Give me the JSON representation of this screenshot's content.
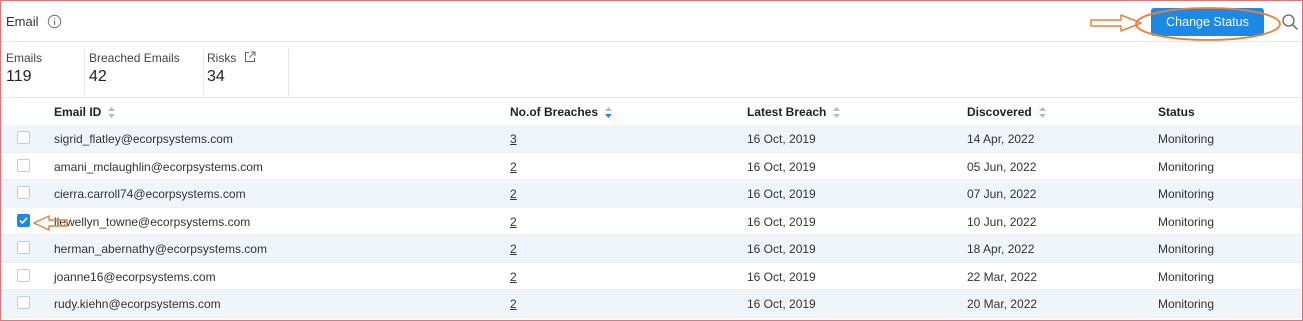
{
  "header": {
    "title": "Email",
    "change_status_label": "Change Status"
  },
  "stats": [
    {
      "label": "Emails",
      "value": "119"
    },
    {
      "label": "Breached Emails",
      "value": "42"
    },
    {
      "label": "Risks",
      "value": "34"
    }
  ],
  "table": {
    "columns": [
      "Email ID",
      "No.of Breaches",
      "Latest Breach",
      "Discovered",
      "Status"
    ],
    "rows": [
      {
        "email": "sigrid_flatley@ecorpsystems.com",
        "breaches": "3",
        "latest": "16 Oct, 2019",
        "discovered": "14 Apr, 2022",
        "status": "Monitoring",
        "checked": false
      },
      {
        "email": "amani_mclaughlin@ecorpsystems.com",
        "breaches": "2",
        "latest": "16 Oct, 2019",
        "discovered": "05 Jun, 2022",
        "status": "Monitoring",
        "checked": false
      },
      {
        "email": "cierra.carroll74@ecorpsystems.com",
        "breaches": "2",
        "latest": "16 Oct, 2019",
        "discovered": "07 Jun, 2022",
        "status": "Monitoring",
        "checked": false
      },
      {
        "email": "llewellyn_towne@ecorpsystems.com",
        "breaches": "2",
        "latest": "16 Oct, 2019",
        "discovered": "10 Jun, 2022",
        "status": "Monitoring",
        "checked": true
      },
      {
        "email": "herman_abernathy@ecorpsystems.com",
        "breaches": "2",
        "latest": "16 Oct, 2019",
        "discovered": "18 Apr, 2022",
        "status": "Monitoring",
        "checked": false
      },
      {
        "email": "joanne16@ecorpsystems.com",
        "breaches": "2",
        "latest": "16 Oct, 2019",
        "discovered": "22 Mar, 2022",
        "status": "Monitoring",
        "checked": false
      },
      {
        "email": "rudy.kiehn@ecorpsystems.com",
        "breaches": "2",
        "latest": "16 Oct, 2019",
        "discovered": "20 Mar, 2022",
        "status": "Monitoring",
        "checked": false
      }
    ]
  },
  "colors": {
    "accent": "#1e88e5",
    "annotation": "#e8823a",
    "frame_border": "#d9777a",
    "row_stripe": "#eef5fb"
  },
  "icons": [
    "info-icon",
    "search-icon",
    "external-link-icon",
    "sort-icon",
    "checkmark-icon",
    "annotation-arrow-icon",
    "annotation-ellipse-icon"
  ]
}
